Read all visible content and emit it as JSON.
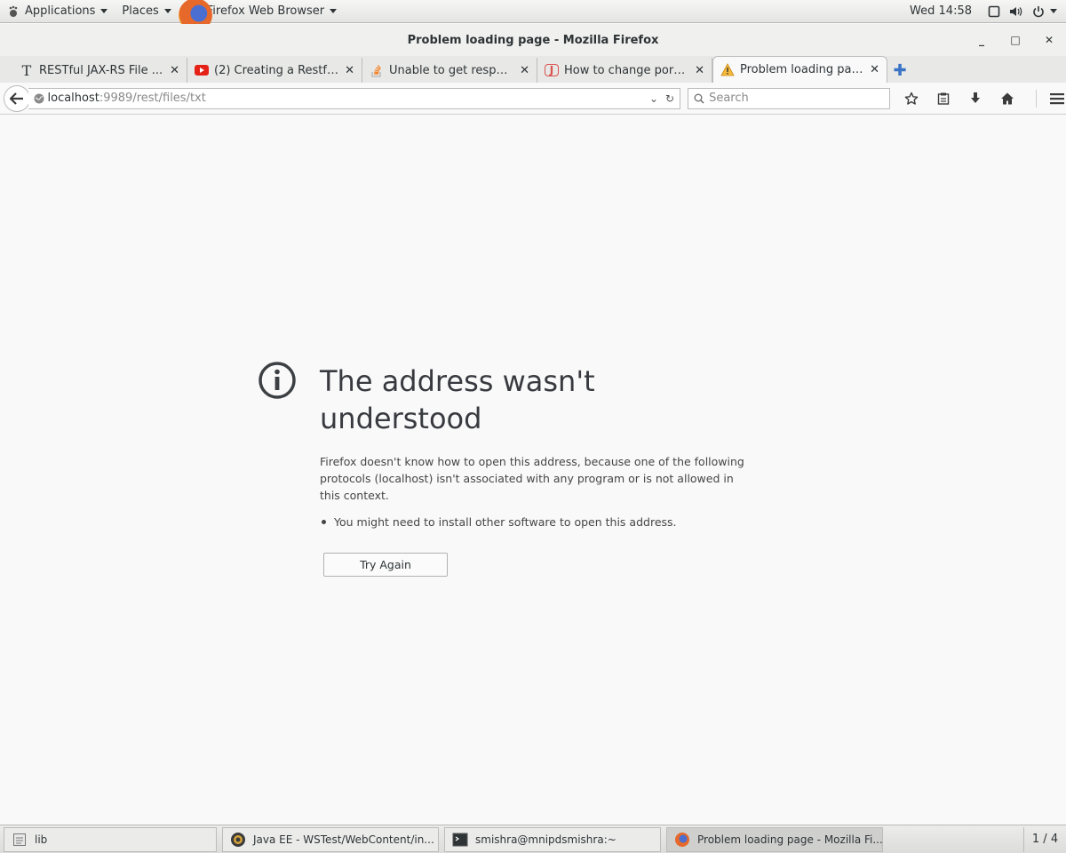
{
  "topbar": {
    "applications": "Applications",
    "places": "Places",
    "app_name": "Firefox Web Browser",
    "clock": "Wed 14:58"
  },
  "window": {
    "title": "Problem loading page - Mozilla Firefox"
  },
  "tabs": [
    {
      "label": "RESTful JAX-RS File ...",
      "icon": "text-icon"
    },
    {
      "label": "(2) Creating a Restful...",
      "icon": "youtube-icon"
    },
    {
      "label": "Unable to get respon...",
      "icon": "stackoverflow-icon"
    },
    {
      "label": "How to change port ...",
      "icon": "j-icon"
    },
    {
      "label": "Problem loading page",
      "icon": "warning-icon",
      "active": true
    }
  ],
  "navbar": {
    "url_host": "localhost",
    "url_rest": ":9989/rest/files/txt",
    "search_placeholder": "Search"
  },
  "error": {
    "title": "The address wasn't understood",
    "description": "Firefox doesn't know how to open this address, because one of the following protocols (localhost) isn't associated with any program or is not allowed in this context.",
    "bullet": "You might need to install other software to open this address.",
    "button": "Try Again"
  },
  "taskbar": {
    "items": [
      {
        "label": "lib"
      },
      {
        "label": "Java EE - WSTest/WebContent/in..."
      },
      {
        "label": "smishra@mnipdsmishra:~"
      },
      {
        "label": "Problem loading page - Mozilla Fi...",
        "active": true
      }
    ],
    "workspace": "1 / 4"
  },
  "colors": {
    "accent": "#3a73c6",
    "page_bg": "#f9f9fa",
    "title_text": "#383a3f"
  }
}
